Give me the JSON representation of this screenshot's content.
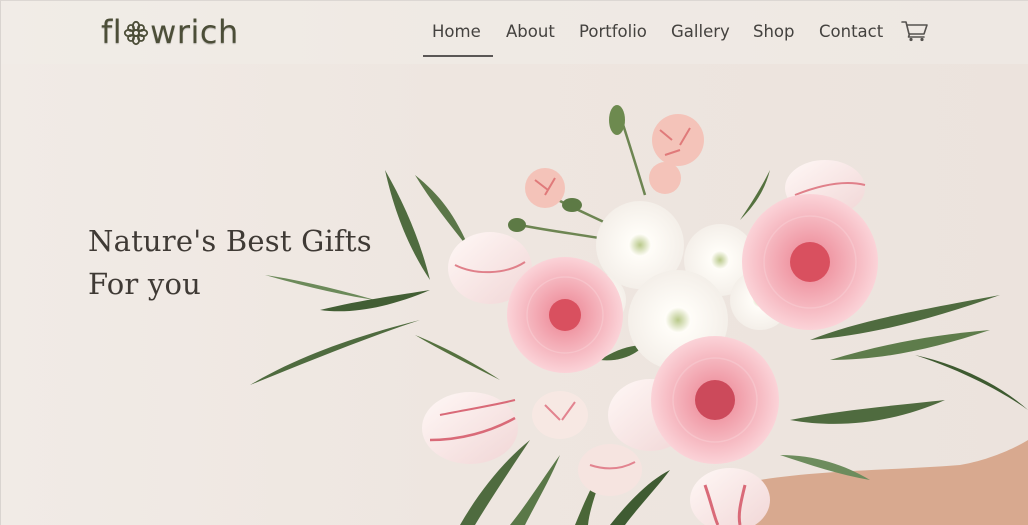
{
  "brand": {
    "logo_prefix": "fl",
    "logo_suffix": "wrich",
    "logo_color": "#4c4e38"
  },
  "nav": {
    "items": [
      {
        "label": "Home",
        "active": true
      },
      {
        "label": "About",
        "active": false
      },
      {
        "label": "Portfolio",
        "active": false
      },
      {
        "label": "Gallery",
        "active": false
      },
      {
        "label": "Shop",
        "active": false
      },
      {
        "label": "Contact",
        "active": false
      }
    ],
    "cart_icon": "shopping-cart-icon"
  },
  "hero": {
    "line1": "Nature's Best Gifts",
    "line2": "For you",
    "image_icon": "flower-bouquet"
  },
  "colors": {
    "background": "#efe8e2",
    "text_dark": "#3f3a35",
    "leaf_green": "#4f6b3f",
    "petal_pink": "#f4b3bd"
  }
}
